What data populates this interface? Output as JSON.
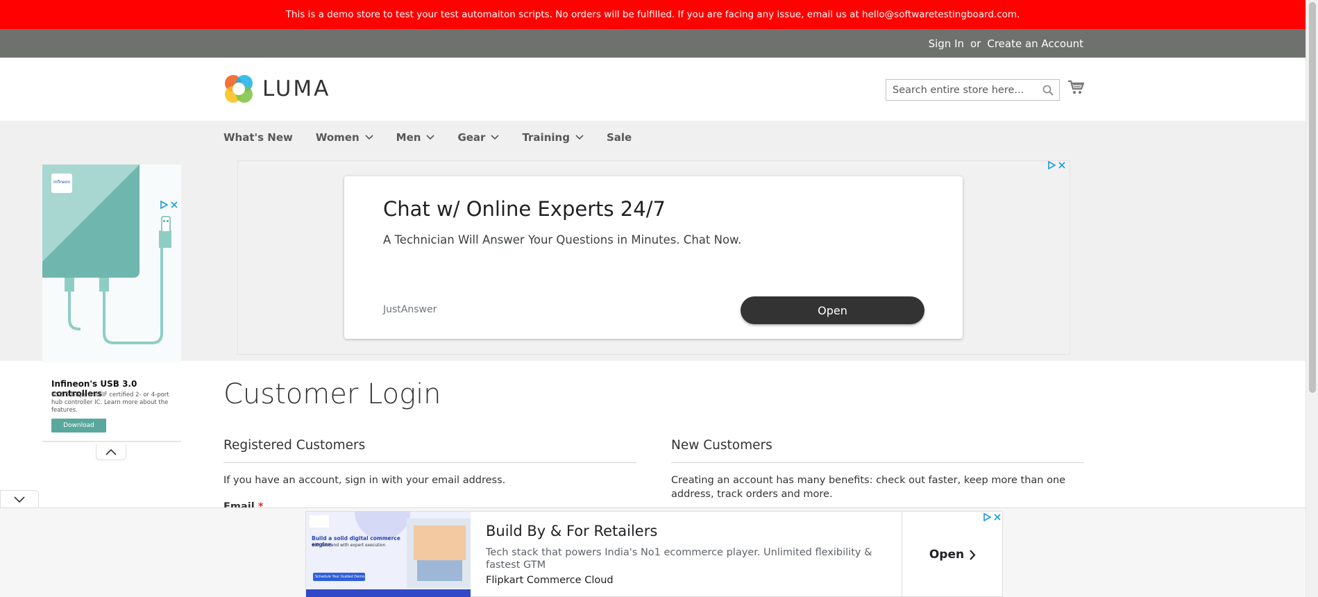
{
  "demo_notice": "This is a demo store to test your test automaiton scripts. No orders will be fulfilled. If you are facing any issue, email us at hello@softwaretestingboard.com.",
  "panel": {
    "sign_in": "Sign In",
    "or": "or",
    "create_account": "Create an Account"
  },
  "logo": {
    "text": "LUMA"
  },
  "search": {
    "placeholder": "Search entire store here..."
  },
  "nav": {
    "items": [
      {
        "label": "What's New",
        "has_submenu": false
      },
      {
        "label": "Women",
        "has_submenu": true
      },
      {
        "label": "Men",
        "has_submenu": true
      },
      {
        "label": "Gear",
        "has_submenu": true
      },
      {
        "label": "Training",
        "has_submenu": true
      },
      {
        "label": "Sale",
        "has_submenu": false
      }
    ]
  },
  "top_ad": {
    "title": "Chat w/ Online Experts 24/7",
    "description": "A Technician Will Answer Your Questions in Minutes. Chat Now.",
    "brand": "JustAnswer",
    "button": "Open"
  },
  "side_ad": {
    "title": "Infineon's USB 3.0 controllers",
    "subtitle": "USB 5 Gbps USB-IF certified 2- or 4-port hub controller IC. Learn more about the features.",
    "button": "Download",
    "logo_text": "infineon"
  },
  "page": {
    "title": "Customer Login",
    "registered": {
      "title": "Registered Customers",
      "text": "If you have an account, sign in with your email address.",
      "email_label": "Email",
      "required_mark": "*"
    },
    "new_customers": {
      "title": "New Customers",
      "text": "Creating an account has many benefits: check out faster, keep more than one address, track orders and more."
    }
  },
  "bottom_ad": {
    "title": "Build By & For Retailers",
    "description": "Tech stack that powers India's No1 ecommerce player. Unlimited flexibility & fastest GTM",
    "brand": "Flipkart Commerce Cloud",
    "button": "Open",
    "thumb_headline": "Build a solid digital commerce engine",
    "thumb_sub": "with fast and with expert execution",
    "thumb_cta": "Schedule Your Guided Demo"
  },
  "colors": {
    "demo_bar": "#ff0101",
    "panel": "#6e716e",
    "nav_bg": "#f0f0f0",
    "required": "#e02b27"
  }
}
